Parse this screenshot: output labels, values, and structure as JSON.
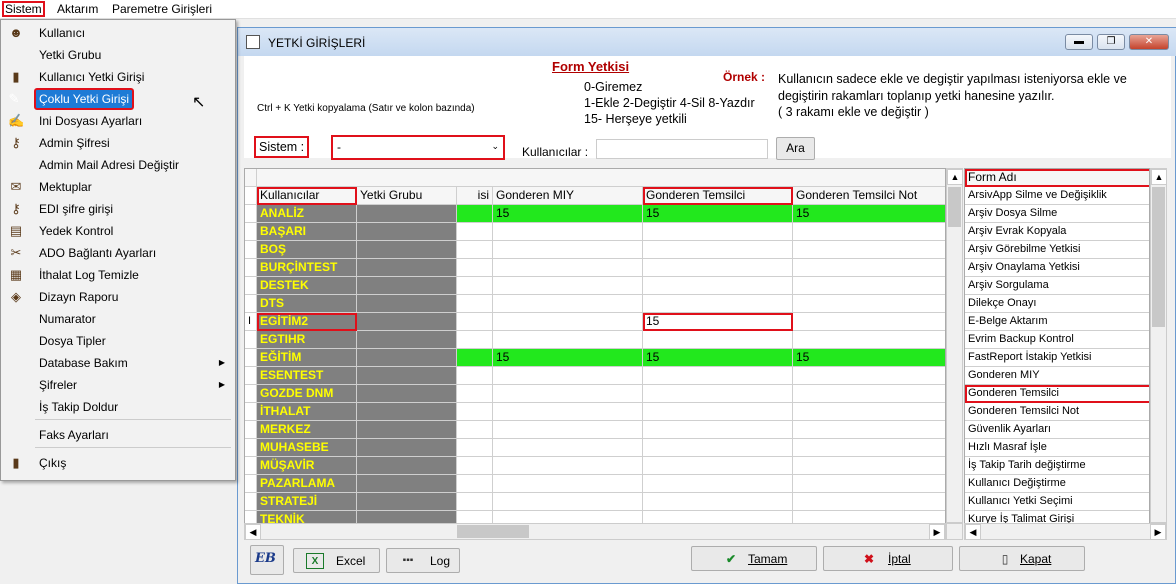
{
  "menubar": {
    "items": [
      "Sistem",
      "Aktarım",
      "Paremetre Girişleri"
    ]
  },
  "menu": {
    "items": [
      {
        "label": "Kullanıcı",
        "icon": "user-icon"
      },
      {
        "label": "Yetki Grubu",
        "icon": ""
      },
      {
        "label": "Kullanıcı Yetki Girişi",
        "icon": "user-key-icon"
      },
      {
        "label": "Çoklu Yetki Girişi",
        "icon": "multi-key-icon"
      },
      {
        "label": "Ini Dosyası  Ayarları",
        "icon": "ini-icon"
      },
      {
        "label": "Admin Şifresi",
        "icon": "key-icon"
      },
      {
        "label": "Admin Mail Adresi Değiştir",
        "icon": ""
      },
      {
        "label": "Mektuplar",
        "icon": "letter-icon"
      },
      {
        "label": "EDI şifre girişi",
        "icon": "edi-key-icon"
      },
      {
        "label": "Yedek Kontrol",
        "icon": "backup-icon"
      },
      {
        "label": "ADO Bağlantı Ayarları",
        "icon": "connection-icon"
      },
      {
        "label": "İthalat Log Temizle",
        "icon": "clean-icon"
      },
      {
        "label": "Dizayn Raporu",
        "icon": "report-icon"
      },
      {
        "label": "Numarator",
        "icon": ""
      },
      {
        "label": "Dosya Tipler",
        "icon": ""
      },
      {
        "label": "Database Bakım",
        "icon": "",
        "submenu": true
      },
      {
        "label": "Şifreler",
        "icon": "",
        "submenu": true
      },
      {
        "label": "İş Takip Doldur",
        "icon": ""
      },
      {
        "label": "Faks Ayarları",
        "icon": ""
      },
      {
        "label": "Çıkış",
        "icon": "exit-icon"
      }
    ]
  },
  "window": {
    "title": "YETKİ GİRİŞLERİ",
    "form_yetkisi": "Form Yetkisi",
    "copy_hint": "Ctrl + K Yetki kopyalama (Satır ve kolon bazında)",
    "legend": [
      "0-Giremez",
      "1-Ekle  2-Degiştir  4-Sil  8-Yazdır",
      "15- Herşeye yetkili"
    ],
    "ornek_label": "Örnek :",
    "ornek_text": [
      "Kullanıcın sadece ekle ve degiştir yapılması isteniyorsa  ekle ve",
      "degiştirin rakamları toplanıp yetki hanesine yazılır.",
      " ( 3 rakamı ekle ve değiştir )"
    ],
    "sistem_label": "Sistem :",
    "sistem_value": "-",
    "kullanicilar_label": "Kullanıcılar :",
    "kullanicilar_value": "",
    "ara_button": "Ara"
  },
  "grid": {
    "headers": [
      "Kullanıcılar",
      "Yetki Grubu",
      "isi",
      "Gonderen MIY",
      "Gonderen Temsilci",
      "Gonderen Temsilci Not"
    ],
    "rows": [
      {
        "user": "ANALİZ",
        "miy": "15",
        "tem": "15",
        "not": "15",
        "green": true
      },
      {
        "user": "BAŞARI",
        "miy": "",
        "tem": "",
        "not": ""
      },
      {
        "user": "BOŞ",
        "miy": "",
        "tem": "",
        "not": ""
      },
      {
        "user": "BURÇİNTEST",
        "miy": "",
        "tem": "",
        "not": ""
      },
      {
        "user": "DESTEK",
        "miy": "",
        "tem": "",
        "not": ""
      },
      {
        "user": "DTS",
        "miy": "",
        "tem": "",
        "not": ""
      },
      {
        "user": "EGİTİM2",
        "miy": "",
        "tem": "15",
        "not": "",
        "editing": true
      },
      {
        "user": "EGTIHR",
        "miy": "",
        "tem": "",
        "not": ""
      },
      {
        "user": "EĞİTİM",
        "miy": "15",
        "tem": "15",
        "not": "15",
        "green": true
      },
      {
        "user": "ESENTEST",
        "miy": "",
        "tem": "",
        "not": ""
      },
      {
        "user": "GOZDE DNM",
        "miy": "",
        "tem": "",
        "not": ""
      },
      {
        "user": "İTHALAT",
        "miy": "",
        "tem": "",
        "not": ""
      },
      {
        "user": "MERKEZ",
        "miy": "",
        "tem": "",
        "not": ""
      },
      {
        "user": "MUHASEBE",
        "miy": "",
        "tem": "",
        "not": ""
      },
      {
        "user": "MÜŞAVİR",
        "miy": "",
        "tem": "",
        "not": ""
      },
      {
        "user": "PAZARLAMA",
        "miy": "",
        "tem": "",
        "not": ""
      },
      {
        "user": "STRATEJİ",
        "miy": "",
        "tem": "",
        "not": ""
      },
      {
        "user": "TEKNİK",
        "miy": "",
        "tem": "",
        "not": ""
      }
    ]
  },
  "forms": {
    "header": "Form Adı",
    "items": [
      "ArsivApp Silme ve Değişiklik",
      "Arşiv Dosya Silme",
      "Arşiv Evrak Kopyala",
      "Arşiv Görebilme Yetkisi",
      "Arşiv Onaylama Yetkisi",
      "Arşiv Sorgulama",
      "Dilekçe Onayı",
      "E-Belge Aktarım",
      "Evrim Backup Kontrol",
      "FastReport İstakip Yetkisi",
      "Gonderen MIY",
      "Gonderen Temsilci",
      "Gonderen Temsilci Not",
      "Güvenlik Ayarları",
      "Hızlı Masraf İşle",
      "İş Takip Tarih değiştirme",
      "Kullanıcı Değiştirme",
      "Kullanıcı Yetki Seçimi",
      "Kurye İş Talimat Girişi"
    ]
  },
  "buttons": {
    "excel": "Excel",
    "log": "Log",
    "tamam": "Tamam",
    "iptal": "İptal",
    "kapat": "Kapat",
    "logo": "EB"
  },
  "colors": {
    "accent": "#1e7bd6",
    "highlight": "#e0101a",
    "green": "#22e81d",
    "user_cell": "#808080",
    "user_text": "#ffff00",
    "title_red": "#b00000"
  }
}
